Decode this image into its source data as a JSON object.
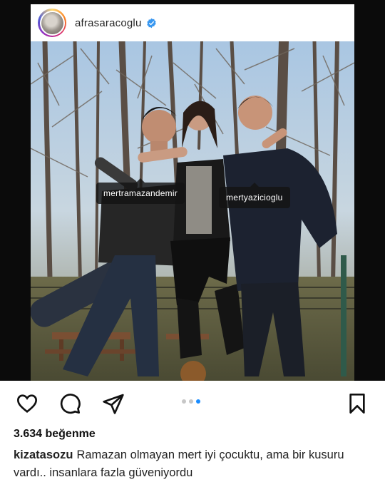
{
  "post": {
    "username": "afrasaracoglu",
    "verified_icon": "verified-badge-icon",
    "accent": "#3897f0",
    "tags": [
      {
        "label": "mertramazandemir"
      },
      {
        "label": "mertyazicioglu"
      }
    ]
  },
  "actions": {
    "like_icon": "heart-icon",
    "comment_icon": "comment-bubble-icon",
    "share_icon": "paper-plane-icon",
    "save_icon": "bookmark-icon",
    "carousel": {
      "count": 3,
      "active": 3
    }
  },
  "likes": "3.634 beğenme",
  "caption": {
    "user": "kizatasozu",
    "text": "Ramazan olmayan mert iyi çocuktu, ama bir kusuru vardı.. insanlara fazla güveniyordu"
  }
}
